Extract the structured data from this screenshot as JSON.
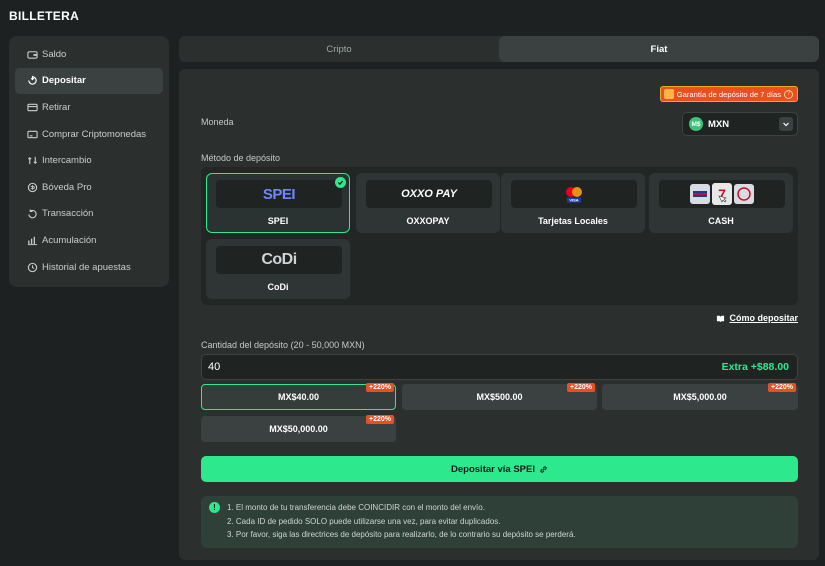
{
  "header": {
    "title": "BILLETERA"
  },
  "sidebar": {
    "items": [
      {
        "label": "Saldo",
        "icon": "wallet-icon",
        "active": false
      },
      {
        "label": "Depositar",
        "icon": "deposit-icon",
        "active": true
      },
      {
        "label": "Retirar",
        "icon": "withdraw-icon",
        "active": false
      },
      {
        "label": "Comprar Criptomonedas",
        "icon": "card-icon",
        "active": false
      },
      {
        "label": "Intercambio",
        "icon": "swap-icon",
        "active": false
      },
      {
        "label": "Bóveda Pro",
        "icon": "vault-icon",
        "active": false
      },
      {
        "label": "Transacción",
        "icon": "transaction-icon",
        "active": false
      },
      {
        "label": "Acumulación",
        "icon": "chart-icon",
        "active": false
      },
      {
        "label": "Historial de apuestas",
        "icon": "history-icon",
        "active": false
      }
    ]
  },
  "tabs": [
    {
      "label": "Cripto",
      "active": false
    },
    {
      "label": "Fiat",
      "active": true
    }
  ],
  "guarantee": {
    "label": "Garantía de depósito de 7 días"
  },
  "currency": {
    "label": "Moneda",
    "coin_text": "M$",
    "code": "MXN"
  },
  "methods": {
    "label": "Método de depósito",
    "items": [
      {
        "name": "SPEI",
        "logo": "SPEI",
        "selected": true
      },
      {
        "name": "OXXOPAY",
        "logo": "OXXO PAY",
        "selected": false
      },
      {
        "name": "Tarjetas Locales",
        "logo": "VISA",
        "selected": false
      },
      {
        "name": "CASH",
        "logo": "7",
        "selected": false
      },
      {
        "name": "CoDi",
        "logo": "CoDi",
        "selected": false
      }
    ]
  },
  "how_to": {
    "label": "Cómo depositar"
  },
  "amount": {
    "label": "Cantidad del depósito (20 - 50,000 MXN)",
    "value": "40",
    "extra": "Extra +$88.00"
  },
  "presets": [
    {
      "label": "MX$40.00",
      "bonus": "+220%",
      "selected": true
    },
    {
      "label": "MX$500.00",
      "bonus": "+220%",
      "selected": false
    },
    {
      "label": "MX$5,000.00",
      "bonus": "+220%",
      "selected": false
    },
    {
      "label": "MX$50,000.00",
      "bonus": "+220%",
      "selected": false
    }
  ],
  "deposit_button": {
    "label": "Depositar vía SPEI"
  },
  "notes": [
    "1. El monto de tu transferencia debe COINCIDIR con el monto del envío.",
    "2. Cada ID de pedido SOLO puede utilizarse una vez, para evitar duplicados.",
    "3. Por favor, siga las directrices de depósito para realizarlo, de lo contrario su depósito se perderá."
  ],
  "colors": {
    "accent": "#2de88c",
    "bonus": "#e8501f",
    "panel": "#2b302f",
    "background": "#1e2121"
  }
}
